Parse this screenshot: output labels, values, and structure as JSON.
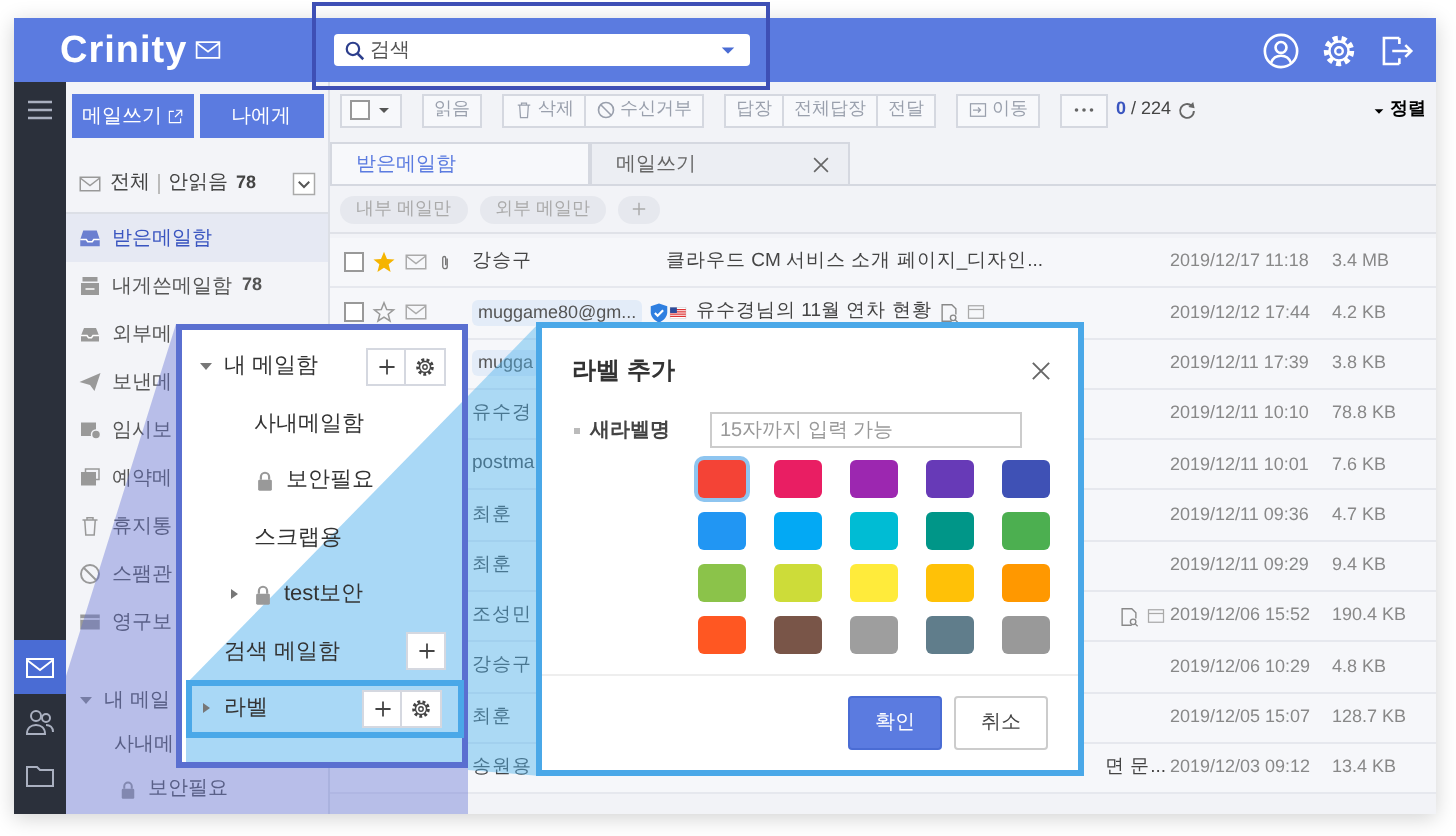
{
  "header": {
    "logo": "Crinity",
    "search": {
      "placeholder": "검색"
    },
    "search_highlighted": true
  },
  "rail": [
    {
      "kind": "menu",
      "selected": false
    },
    {
      "kind": "mail",
      "selected": true
    },
    {
      "kind": "contacts",
      "selected": false
    },
    {
      "kind": "folder",
      "selected": false
    }
  ],
  "sidebar": {
    "buttons": [
      {
        "label": "메일쓰기",
        "kind": "compose"
      },
      {
        "label": "나에게",
        "kind": "self"
      }
    ],
    "filter": {
      "all": "전체",
      "unread_label": "안읽음",
      "unread_count": "78"
    },
    "folders": [
      {
        "kind": "inbox",
        "label": "받은메일함",
        "selected": true
      },
      {
        "kind": "self",
        "label": "내게쓴메일함",
        "count": "78",
        "selected": false
      },
      {
        "kind": "external",
        "label": "외부메",
        "selected": false
      },
      {
        "kind": "sent",
        "label": "보낸메",
        "selected": false
      },
      {
        "kind": "drafts",
        "label": "임시보",
        "selected": false
      },
      {
        "kind": "scheduled",
        "label": "예약메",
        "selected": false
      },
      {
        "kind": "trash",
        "label": "휴지통",
        "selected": false
      },
      {
        "kind": "spam",
        "label": "스팸관",
        "selected": false
      },
      {
        "kind": "archive",
        "label": "영구보",
        "selected": false
      },
      {
        "kind": "group",
        "label": "내 메일",
        "expanded": true,
        "selected": false
      },
      {
        "kind": "folder",
        "label": "사내메",
        "selected": false
      },
      {
        "kind": "locked",
        "label": "보안필요",
        "selected": false
      }
    ]
  },
  "toolbar": {
    "select_all_checked": false,
    "groups": [
      [
        {
          "kind": "plain",
          "label": "읽음"
        }
      ],
      [
        {
          "kind": "delete",
          "label": "삭제"
        },
        {
          "kind": "block",
          "label": "수신거부"
        }
      ],
      [
        {
          "kind": "plain",
          "label": "답장"
        },
        {
          "kind": "plain",
          "label": "전체답장"
        },
        {
          "kind": "plain",
          "label": "전달"
        }
      ],
      [
        {
          "kind": "move",
          "label": "이동"
        }
      ]
    ],
    "count": "0",
    "total": "/ 224",
    "sort": "정렬"
  },
  "tabs": [
    {
      "label": "받은메일함",
      "selected": true,
      "closable": false
    },
    {
      "label": "메일쓰기",
      "selected": false,
      "closable": true
    }
  ],
  "filter_chips": [
    "내부 메일만",
    "외부 메일만"
  ],
  "rows": [
    {
      "checked": false,
      "starred": true,
      "attachment": true,
      "sender": "강승구",
      "sender_chip": false,
      "subject": "클라우드 CM 서비스 소개 페이지_디자인...",
      "date": "2019/12/17 11:18",
      "size": "3.4 MB"
    },
    {
      "checked": false,
      "starred": false,
      "attachment": false,
      "sender": "muggame80@gm...",
      "sender_chip": true,
      "verified": true,
      "flag": true,
      "subject": "유수경님의 11월 연차 현황",
      "preview_icons": true,
      "date": "2019/12/12 17:44",
      "size": "4.2 KB"
    },
    {
      "sender": "mugga",
      "sender_chip": true,
      "date": "2019/12/11 17:39",
      "size": "3.8 KB"
    },
    {
      "sender": "유수경",
      "sender_chip": false,
      "date": "2019/12/11 10:10",
      "size": "78.8 KB"
    },
    {
      "sender": "postma",
      "sender_chip": false,
      "date": "2019/12/11 10:01",
      "size": "7.6 KB"
    },
    {
      "sender": "최훈",
      "sender_chip": false,
      "date": "2019/12/11 09:36",
      "size": "4.7 KB"
    },
    {
      "sender": "최훈",
      "sender_chip": false,
      "date": "2019/12/11 09:29",
      "size": "9.4 KB"
    },
    {
      "sender": "조성민",
      "sender_chip": false,
      "preview_icons": true,
      "date": "2019/12/06 15:52",
      "size": "190.4 KB"
    },
    {
      "sender": "강승구",
      "sender_chip": false,
      "date": "2019/12/06 10:29",
      "size": "4.8 KB"
    },
    {
      "sender": "최훈",
      "sender_chip": false,
      "date": "2019/12/05 15:07",
      "size": "128.7 KB"
    },
    {
      "sender": "송원용",
      "sender_chip": false,
      "subject_tail": "면 문...",
      "date": "2019/12/03 09:12",
      "size": "13.4 KB"
    }
  ],
  "folder_callout": {
    "items": [
      {
        "kind": "group",
        "label": "내 메일함",
        "expanded": true,
        "add": true,
        "settings": true,
        "highlighted": false
      },
      {
        "kind": "folder",
        "label": "사내메일함",
        "highlighted": false
      },
      {
        "kind": "locked",
        "label": "보안필요",
        "highlighted": false
      },
      {
        "kind": "folder",
        "label": "스크랩용",
        "highlighted": false
      },
      {
        "kind": "locked",
        "label": "test보안",
        "expanded": false,
        "highlighted": false
      },
      {
        "kind": "group",
        "label": "검색 메일함",
        "add": true,
        "settings": false,
        "highlighted": false
      },
      {
        "kind": "group",
        "label": "라벨",
        "expanded": false,
        "add": true,
        "settings": true,
        "highlighted": true
      }
    ]
  },
  "dialog": {
    "title": "라벨 추가",
    "field_label": "새라벨명",
    "placeholder": "15자까지 입력 가능",
    "colors": [
      {
        "color": "#f44336",
        "selected": true
      },
      {
        "color": "#e91e63",
        "selected": false
      },
      {
        "color": "#9c27b0",
        "selected": false
      },
      {
        "color": "#673ab7",
        "selected": false
      },
      {
        "color": "#3f51b5",
        "selected": false
      },
      {
        "color": "#2196f3",
        "selected": false
      },
      {
        "color": "#03a9f4",
        "selected": false
      },
      {
        "color": "#00bcd4",
        "selected": false
      },
      {
        "color": "#009688",
        "selected": false
      },
      {
        "color": "#4caf50",
        "selected": false
      },
      {
        "color": "#8bc34a",
        "selected": false
      },
      {
        "color": "#cddc39",
        "selected": false
      },
      {
        "color": "#ffeb3b",
        "selected": false
      },
      {
        "color": "#ffc107",
        "selected": false
      },
      {
        "color": "#ff9800",
        "selected": false
      },
      {
        "color": "#ff5722",
        "selected": false
      },
      {
        "color": "#795548",
        "selected": false
      },
      {
        "color": "#9e9e9e",
        "selected": false
      },
      {
        "color": "#607d8b",
        "selected": false
      },
      {
        "color": "#999999",
        "selected": false
      }
    ],
    "buttons": [
      {
        "label": "확인",
        "kind": "primary"
      },
      {
        "label": "취소",
        "kind": "secondary"
      }
    ]
  }
}
